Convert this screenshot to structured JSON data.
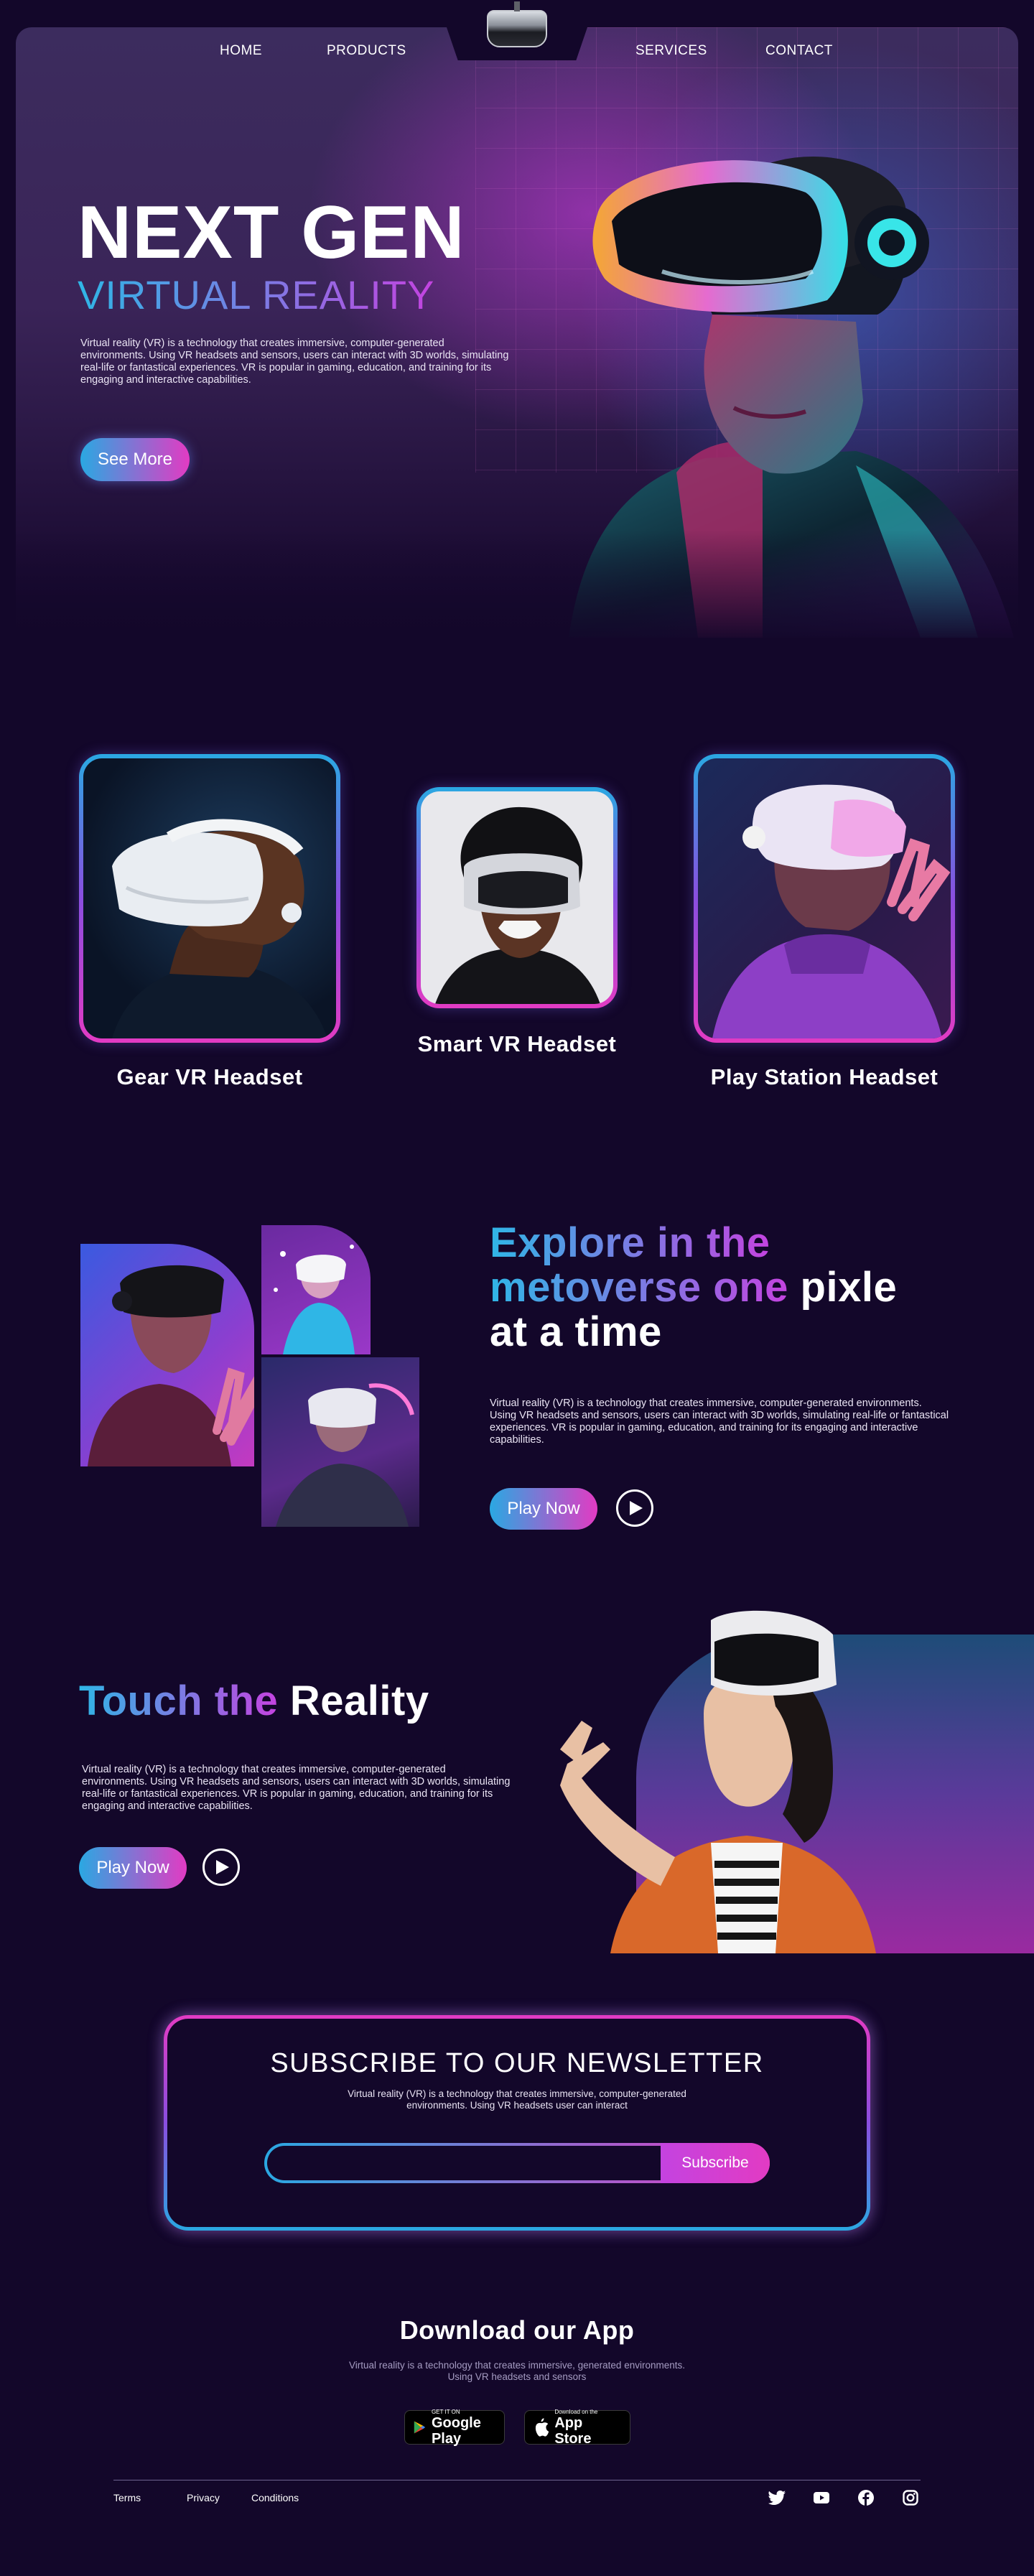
{
  "nav": {
    "items": [
      "HOME",
      "PRODUCTS",
      "SERVICES",
      "CONTACT"
    ]
  },
  "hero": {
    "title": "NEXT GEN",
    "subtitle": "VIRTUAL REALITY",
    "paragraph": "Virtual reality (VR) is a technology that creates immersive, computer-generated environments. Using VR headsets and sensors, users can interact with 3D worlds, simulating real-life or fantastical experiences. VR is popular in gaming, education, and training for its engaging and interactive capabilities.",
    "button": "See More"
  },
  "headsets": [
    {
      "label": "Gear VR Headset"
    },
    {
      "label": "Smart VR Headset"
    },
    {
      "label": "Play Station Headset"
    }
  ],
  "explore": {
    "heading_line1": "Explore in the",
    "heading_line2_gradient": "metoverse one",
    "heading_line2_plain": "pixle",
    "heading_line3": "at a time",
    "paragraph": "Virtual reality (VR) is a technology that creates immersive, computer-generated environments. Using VR headsets and sensors, users can interact with 3D worlds, simulating real-life or fantastical experiences. VR is popular in gaming, education, and training for its engaging and interactive capabilities.",
    "button": "Play Now"
  },
  "touch": {
    "heading_gradient": "Touch the",
    "heading_plain": "Reality",
    "paragraph": "Virtual reality (VR) is a technology that creates immersive, computer-generated environments. Using VR headsets and sensors, users can interact with 3D worlds, simulating real-life or fantastical experiences. VR is popular in gaming, education, and training for its engaging and interactive capabilities.",
    "button": "Play Now"
  },
  "newsletter": {
    "title": "SUBSCRIBE TO OUR NEWSLETTER",
    "paragraph": "Virtual reality (VR) is a technology that creates immersive, computer-generated environments. Using VR headsets user can interact",
    "input_value": "",
    "button": "Subscribe"
  },
  "app": {
    "title": "Download our App",
    "paragraph_line1": "Virtual reality is a technology that creates immersive, generated environments.",
    "paragraph_line2": "Using VR headsets and sensors",
    "google_small": "GET IT ON",
    "google_big": "Google Play",
    "apple_small": "Download on the",
    "apple_big": "App Store"
  },
  "footer": {
    "links": [
      "Terms",
      "Privacy",
      "Conditions"
    ],
    "social": [
      "twitter-icon",
      "youtube-icon",
      "facebook-icon",
      "instagram-icon"
    ]
  },
  "colors": {
    "background": "#13072a",
    "accent_blue": "#2aa8e2",
    "accent_pink": "#e23bc3",
    "accent_purple": "#8a4ee0"
  }
}
